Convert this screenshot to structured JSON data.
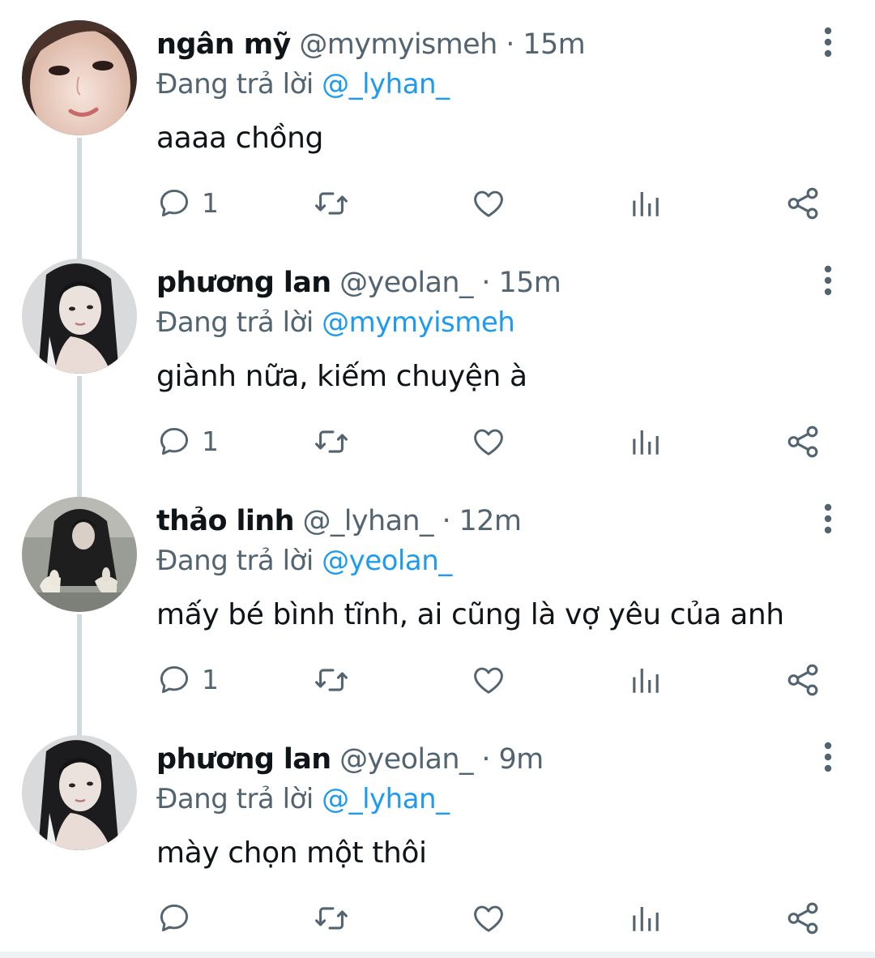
{
  "replying_prefix": "Đang trả lời",
  "separator": "·",
  "tweets": [
    {
      "name": "ngân mỹ",
      "handle": "@mymyismeh",
      "time": "15m",
      "reply_to": "@_lyhan_",
      "text": "aaaa chồng",
      "reply_count": "1"
    },
    {
      "name": "phương lan",
      "handle": "@yeolan_",
      "time": "15m",
      "reply_to": "@mymyismeh",
      "text": "giành nữa, kiếm chuyện à",
      "reply_count": "1"
    },
    {
      "name": "thảo linh",
      "handle": "@_lyhan_",
      "time": "12m",
      "reply_to": "@yeolan_",
      "text": "mấy bé bình tĩnh, ai cũng là vợ yêu của anh",
      "reply_count": "1"
    },
    {
      "name": "phương lan",
      "handle": "@yeolan_",
      "time": "9m",
      "reply_to": "@_lyhan_",
      "text": "mày chọn một thôi",
      "reply_count": ""
    }
  ],
  "icons": {
    "reply": "reply-icon",
    "retweet": "retweet-icon",
    "like": "heart-icon",
    "views": "analytics-icon",
    "share": "share-icon",
    "more": "more-vertical-icon"
  },
  "colors": {
    "text_primary": "#0f1419",
    "text_secondary": "#536471",
    "mention": "#1d9bf0",
    "thread_line": "#cfd9de"
  }
}
